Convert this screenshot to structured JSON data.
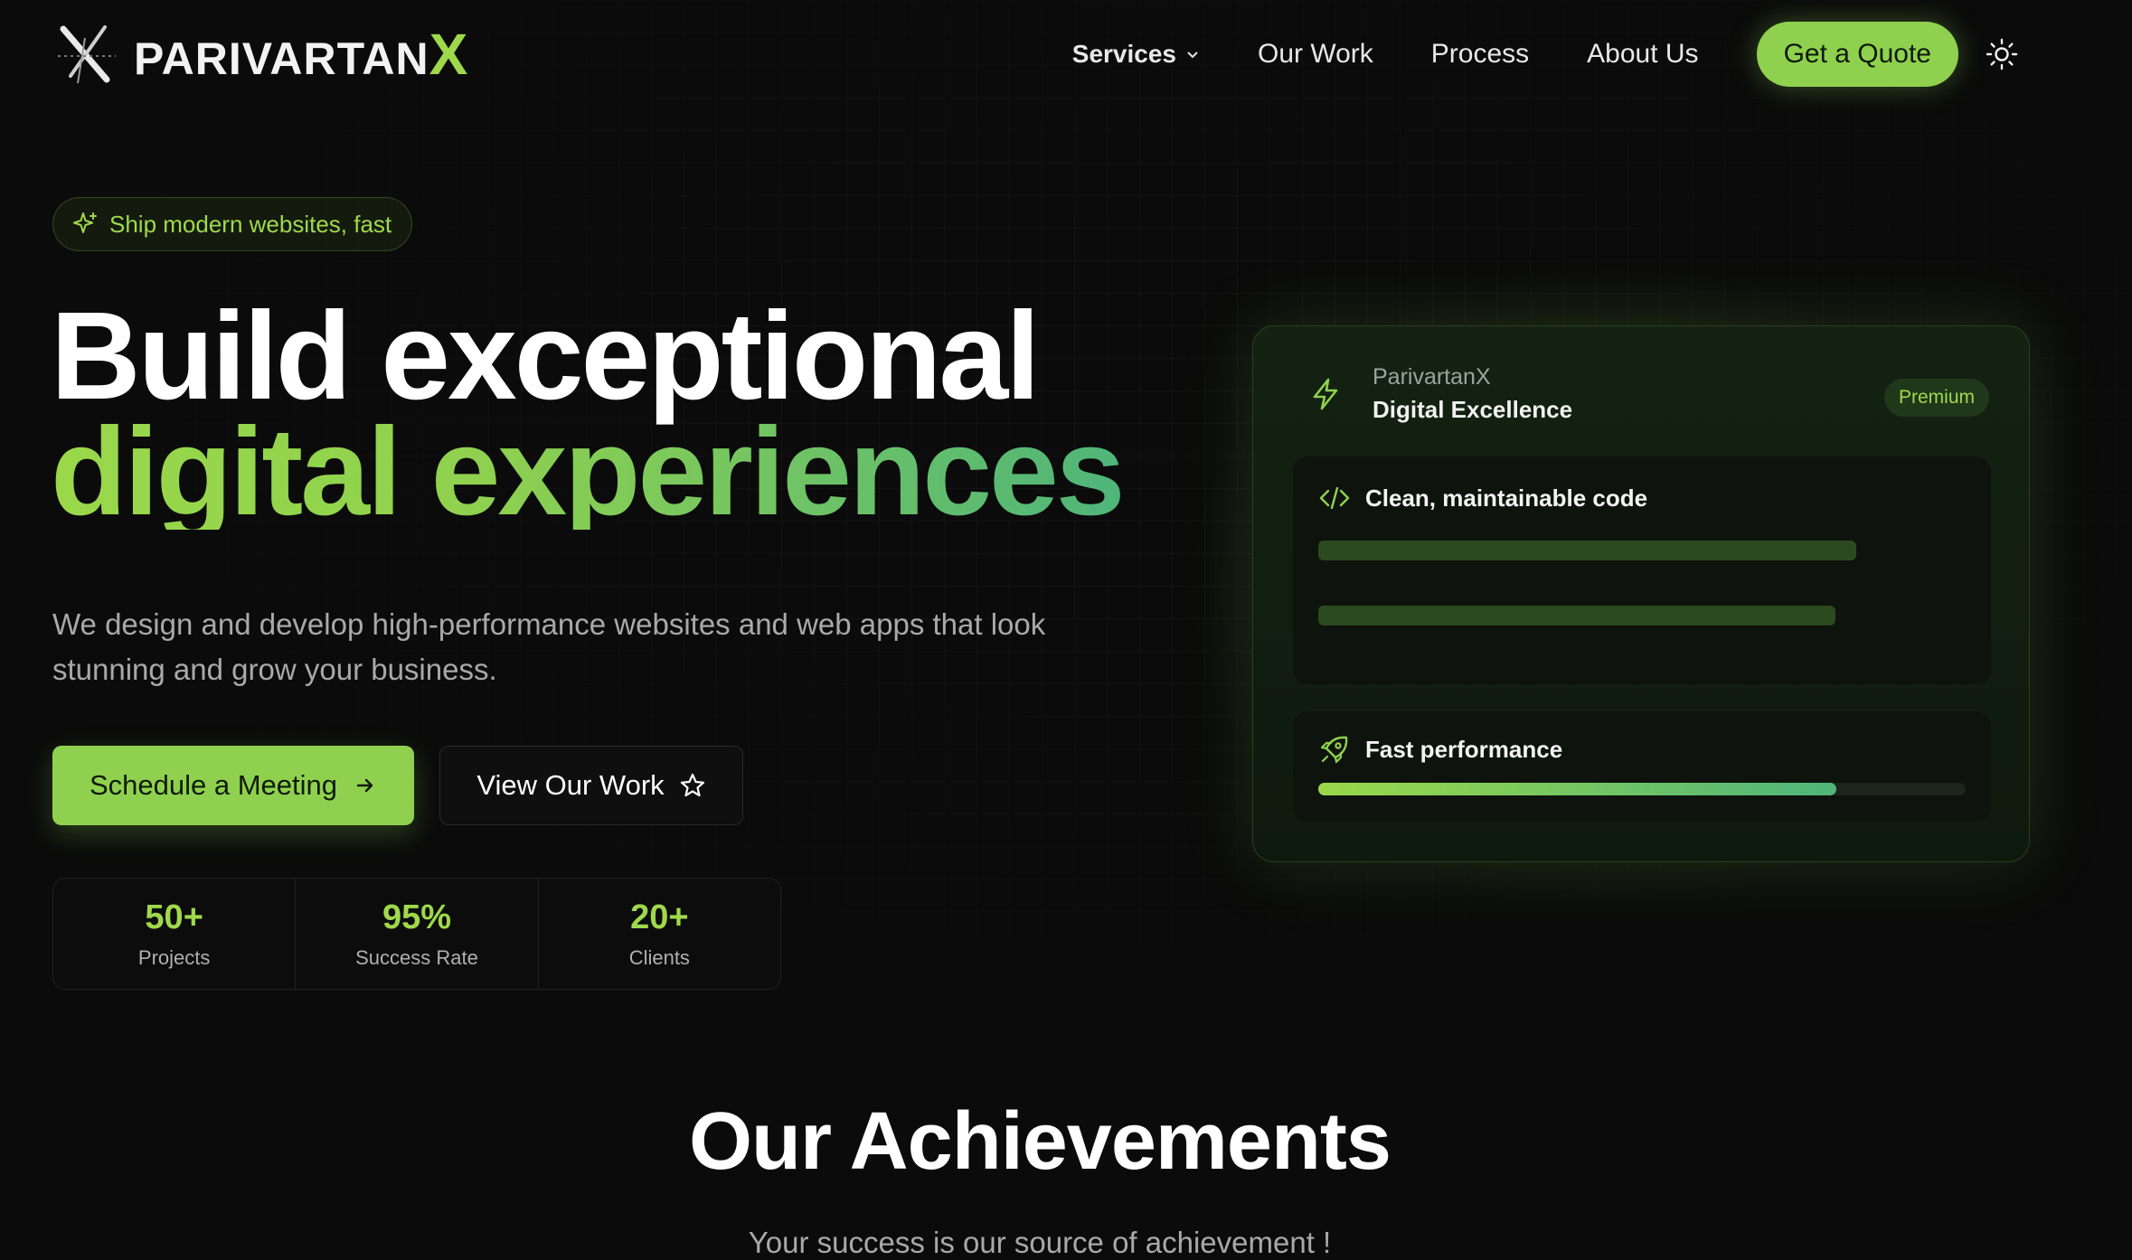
{
  "brand": {
    "name_main": "PARIVARTAN",
    "name_accent": "X"
  },
  "nav": {
    "services": "Services",
    "our_work": "Our Work",
    "process": "Process",
    "about": "About Us",
    "cta": "Get a Quote"
  },
  "hero": {
    "pill": "Ship modern websites, fast",
    "title_line1": "Build exceptional",
    "title_line2": "digital experiences",
    "lede": "We design and develop high-performance websites and web apps that look stunning and grow your business.",
    "primary_btn": "Schedule a Meeting",
    "secondary_btn": "View Our Work",
    "stats": [
      {
        "value": "50+",
        "label": "Projects"
      },
      {
        "value": "95%",
        "label": "Success Rate"
      },
      {
        "value": "20+",
        "label": "Clients"
      }
    ]
  },
  "card": {
    "brand": "ParivartanX",
    "subtitle": "Digital Excellence",
    "badge": "Premium",
    "code_title": "Clean, maintainable code",
    "perf_title": "Fast performance",
    "perf_progress": 0.8
  },
  "achievements": {
    "title": "Our Achievements",
    "subtitle": "Your success is our source of achievement !"
  },
  "colors": {
    "accent": "#8fd14f",
    "accent_teal": "#4fb57a",
    "background": "#0b0b0b"
  }
}
